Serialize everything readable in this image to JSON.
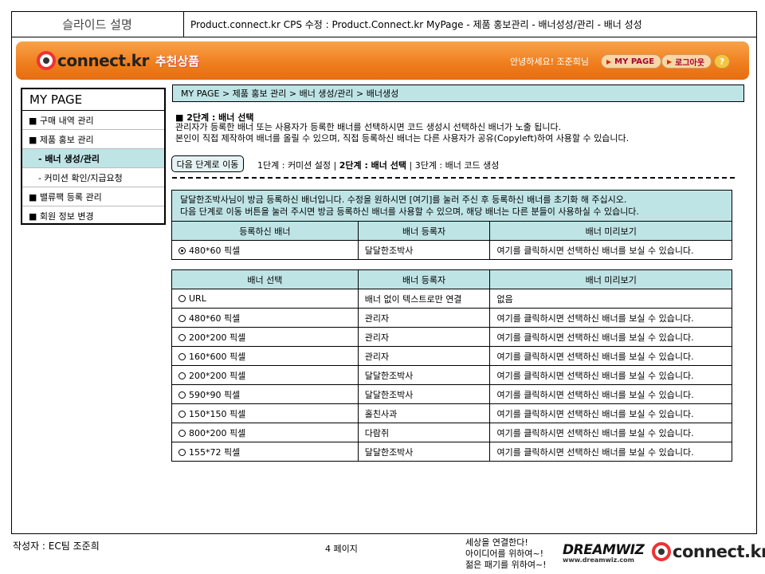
{
  "spec": {
    "title": "슬라이드 설명",
    "description": "Product.connect.kr CPS 수정 : Product.Connect.kr MyPage - 제품 홍보관리 - 배너성성/관리 - 배너 성성"
  },
  "banner": {
    "logo": "connect.kr",
    "logo_sub": "추천상품",
    "greeting": "안녕하세요! 조준희님",
    "mypage_btn": "MY PAGE",
    "logout_btn": "로그아웃",
    "help_btn": "?"
  },
  "sidebar": {
    "title": "MY PAGE",
    "items": [
      {
        "label": "■ 구매 내역 관리"
      },
      {
        "label": "■ 제품 홍보 관리"
      },
      {
        "label": "- 배너 생성/관리"
      },
      {
        "label": "- 커미션 확인/지급요청"
      },
      {
        "label": "■ 밸류팩 등록 관리"
      },
      {
        "label": "■ 회원 정보 변경"
      }
    ]
  },
  "breadcrumb": "MY PAGE > 제품 홍보 관리 > 배너 생성/관리 > 배너생성",
  "step": {
    "heading": "■ 2단계 : 배너 선택",
    "desc1": "관리자가 등록한 배너 또는 사용자가 등록한 배너를 선택하시면 코드 생성시 선택하신 배너가 노출 됩니다.",
    "desc2": "본인이 직접 제작하여 배너를 올릴 수 있으며, 직접 등록하신 배너는 다른 사용자가 공유(Copyleft)하여 사용할 수 있습니다.",
    "next_button": "다음 단계로 이동",
    "step1": "1단계 : 커미션 설정 | ",
    "step2": "2단계 : 배너 선택",
    "step3": " | 3단계 : 배너 코드 생성"
  },
  "notice": {
    "line1": "달달한조박사님이 방금 등록하신 배너입니다. 수정을 원하시면 [여기]를 눌러 주신 후 등록하신 배너를 초기화 해 주십시오.",
    "line2": "다음 단계로 이동 버튼을 눌러 주시면 방금 등록하신 배너를 사용할 수 있으며, 해당 배너는 다른 분들이 사용하실 수 있습니다."
  },
  "registered_table": {
    "headers": [
      "등록하신 배너",
      "배너 등록자",
      "배너 미리보기"
    ],
    "rows": [
      {
        "banner": "480*60 픽셀",
        "owner": "달달한조박사",
        "preview": "여기를 클릭하시면 선택하신 배너를 보실 수 있습니다.",
        "selected": true
      }
    ]
  },
  "select_table": {
    "headers": [
      "배너 선택",
      "배너 등록자",
      "배너 미리보기"
    ],
    "rows": [
      {
        "banner": "URL",
        "owner": "배너 없이 텍스트로만 연결",
        "preview": "없음"
      },
      {
        "banner": "480*60 픽셀",
        "owner": "관리자",
        "preview": "여기를 클릭하시면 선택하신 배너를 보실 수 있습니다."
      },
      {
        "banner": "200*200 픽셀",
        "owner": "관리자",
        "preview": "여기를 클릭하시면 선택하신 배너를 보실 수 있습니다."
      },
      {
        "banner": "160*600 픽셀",
        "owner": "관리자",
        "preview": "여기를 클릭하시면 선택하신 배너를 보실 수 있습니다."
      },
      {
        "banner": "200*200 픽셀",
        "owner": "달달한조박사",
        "preview": "여기를 클릭하시면 선택하신 배너를 보실 수 있습니다."
      },
      {
        "banner": "590*90 픽셀",
        "owner": "달달한조박사",
        "preview": "여기를 클릭하시면 선택하신 배너를 보실 수 있습니다."
      },
      {
        "banner": "150*150 픽셀",
        "owner": "홀친사과",
        "preview": "여기를 클릭하시면 선택하신 배너를 보실 수 있습니다."
      },
      {
        "banner": "800*200 픽셀",
        "owner": "다람쥐",
        "preview": "여기를 클릭하시면 선택하신 배너를 보실 수 있습니다."
      },
      {
        "banner": "155*72 픽셀",
        "owner": "달달한조박사",
        "preview": "여기를 클릭하시면 선택하신 배너를 보실 수 있습니다."
      }
    ]
  },
  "footer": {
    "author": "작성자 : EC팀 조준희",
    "page": "4 페이지",
    "slogan1": "세상을 연결한다!",
    "slogan2": "아이디어를 위하여~!",
    "slogan3": "젊은 패기를 위하여~!",
    "dreamwiz": "DREAMWIZ",
    "dreamwiz_url": "www.dreamwiz.com",
    "logo": "connect.kr"
  },
  "colors": {
    "accent_teal": "#bfe4e6",
    "banner_orange": "#ef7d1c"
  }
}
